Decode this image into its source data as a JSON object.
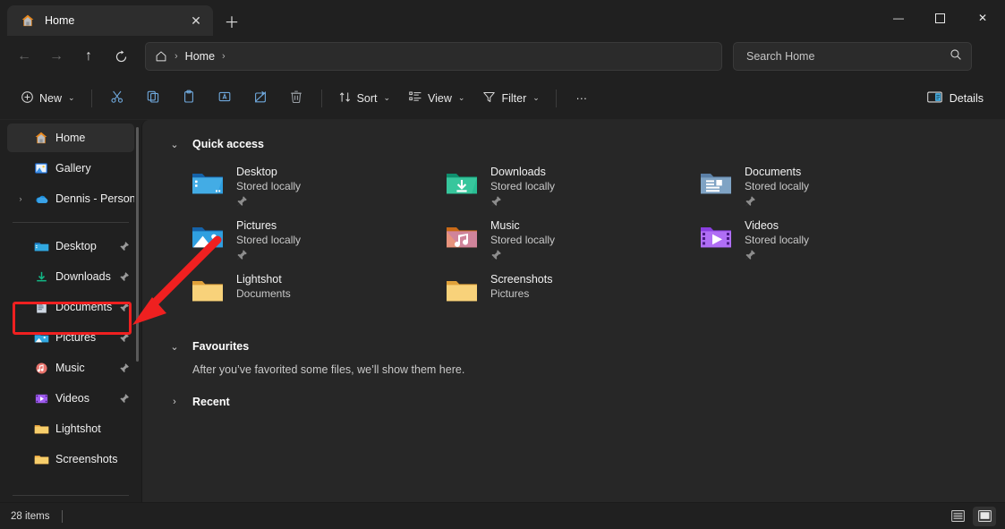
{
  "window": {
    "tab_title": "Home",
    "tab_icon": "home-icon",
    "close_tab_glyph": "✕",
    "new_tab_glyph": "＋",
    "minimize_glyph": "—",
    "maximize_glyph": "▢",
    "close_glyph": "✕"
  },
  "nav": {
    "back_glyph": "←",
    "forward_glyph": "→",
    "up_glyph": "↑",
    "refresh_glyph": "⟳",
    "breadcrumb_home_icon": "home-icon",
    "breadcrumb_sep": "›",
    "breadcrumb_current": "Home",
    "breadcrumb_trailing_sep": "›"
  },
  "search": {
    "placeholder": "Search Home",
    "icon": "search-icon"
  },
  "toolbar": {
    "new_label": "New",
    "new_icon": "plus-circle-icon",
    "cut_icon": "scissors-icon",
    "copy_icon": "copy-icon",
    "paste_icon": "clipboard-icon",
    "rename_icon": "rename-icon",
    "share_icon": "share-icon",
    "delete_icon": "trash-icon",
    "sort_label": "Sort",
    "sort_icon": "sort-arrows-icon",
    "view_label": "View",
    "view_icon": "view-list-icon",
    "filter_label": "Filter",
    "filter_icon": "funnel-icon",
    "more_label": "···",
    "details_label": "Details",
    "details_icon": "details-pane-icon",
    "chevron": "⌄"
  },
  "sidebar": {
    "top_items": [
      {
        "label": "Home",
        "icon": "home-icon",
        "selected": true,
        "expander": false,
        "pinned": false
      },
      {
        "label": "Gallery",
        "icon": "gallery-icon",
        "selected": false,
        "expander": false,
        "pinned": false
      },
      {
        "label": "Dennis - Person",
        "icon": "onedrive-icon",
        "selected": false,
        "expander": true,
        "pinned": false
      }
    ],
    "pinned_items": [
      {
        "label": "Desktop",
        "icon": "desktop-folder-icon",
        "pinned": true
      },
      {
        "label": "Downloads",
        "icon": "downloads-folder-icon",
        "pinned": true
      },
      {
        "label": "Documents",
        "icon": "documents-folder-icon",
        "pinned": true,
        "highlighted": true
      },
      {
        "label": "Pictures",
        "icon": "pictures-folder-icon",
        "pinned": true
      },
      {
        "label": "Music",
        "icon": "music-folder-icon",
        "pinned": true
      },
      {
        "label": "Videos",
        "icon": "videos-folder-icon",
        "pinned": true
      },
      {
        "label": "Lightshot",
        "icon": "folder-icon",
        "pinned": false
      },
      {
        "label": "Screenshots",
        "icon": "folder-icon",
        "pinned": false
      }
    ],
    "expander_glyph": "›",
    "pin_glyph": "📌"
  },
  "main": {
    "quick_access": {
      "title": "Quick access",
      "chevron": "⌄",
      "items": [
        {
          "name": "Desktop",
          "sub": "Stored locally",
          "icon": "desktop-folder-icon",
          "pinned": true
        },
        {
          "name": "Downloads",
          "sub": "Stored locally",
          "icon": "downloads-folder-icon",
          "pinned": true
        },
        {
          "name": "Documents",
          "sub": "Stored locally",
          "icon": "documents-folder-icon",
          "pinned": true
        },
        {
          "name": "Pictures",
          "sub": "Stored locally",
          "icon": "pictures-folder-icon",
          "pinned": true
        },
        {
          "name": "Music",
          "sub": "Stored locally",
          "icon": "music-folder-icon",
          "pinned": true
        },
        {
          "name": "Videos",
          "sub": "Stored locally",
          "icon": "videos-folder-icon",
          "pinned": true
        },
        {
          "name": "Lightshot",
          "sub": "Documents",
          "icon": "folder-icon",
          "pinned": false
        },
        {
          "name": "Screenshots",
          "sub": "Pictures",
          "icon": "folder-icon",
          "pinned": false
        }
      ]
    },
    "favourites": {
      "title": "Favourites",
      "chevron": "⌄",
      "empty_text": "After you’ve favorited some files, we’ll show them here."
    },
    "recent": {
      "title": "Recent",
      "chevron": "›"
    }
  },
  "statusbar": {
    "item_count": "28 items",
    "details_view_icon": "details-view-icon",
    "large_icons_view_icon": "large-icons-view-icon"
  },
  "annotations": {
    "highlight_color": "#ef2020",
    "arrow_target": "sidebar-item-documents"
  }
}
